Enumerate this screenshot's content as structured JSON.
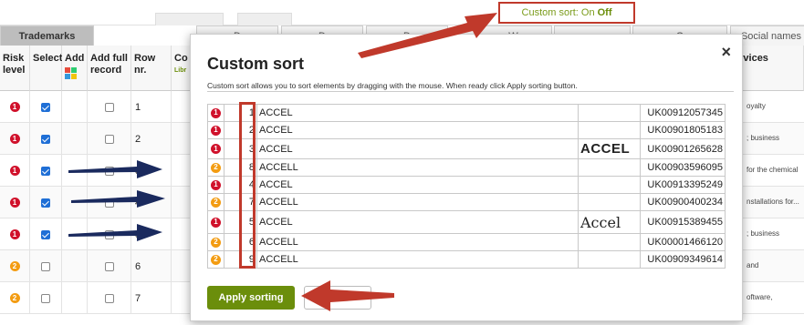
{
  "top_badge": {
    "prefix": "Custom sort: On",
    "state": "Off"
  },
  "tabs": [
    "Trademarks",
    "D",
    "D",
    "D",
    "W",
    "",
    "O",
    "Social names"
  ],
  "columns": {
    "risk": "Risk level",
    "select": "Select",
    "add": "Add",
    "add_full": "Add full record",
    "row_nr": "Row nr.",
    "co": "Co",
    "co_sub": "Libr",
    "services": "ervices"
  },
  "bg_rows": [
    {
      "risk": "1",
      "risk_level": 1,
      "checked": true,
      "nr": "1",
      "svc": "oyalty"
    },
    {
      "risk": "1",
      "risk_level": 1,
      "checked": true,
      "nr": "2",
      "svc": "; business"
    },
    {
      "risk": "1",
      "risk_level": 1,
      "checked": true,
      "nr": "3",
      "svc": "for the chemical"
    },
    {
      "risk": "1",
      "risk_level": 1,
      "checked": true,
      "nr": "4",
      "svc": "nstallations for..."
    },
    {
      "risk": "1",
      "risk_level": 1,
      "checked": true,
      "nr": "5",
      "svc": "; business"
    },
    {
      "risk": "2",
      "risk_level": 2,
      "checked": false,
      "nr": "6",
      "svc": "and"
    },
    {
      "risk": "2",
      "risk_level": 2,
      "checked": false,
      "nr": "7",
      "svc": "oftware,"
    }
  ],
  "modal": {
    "title": "Custom sort",
    "close": "×",
    "description": "Custom sort allows you to sort elements by dragging with the mouse. When ready click Apply sorting button.",
    "apply_label": "Apply sorting",
    "cancel_label": "",
    "rows": [
      {
        "risk": "1",
        "pos": "1",
        "name": "ACCEL",
        "logo": "",
        "number": "UK00912057345"
      },
      {
        "risk": "1",
        "pos": "2",
        "name": "ACCEL",
        "logo": "",
        "number": "UK00901805183"
      },
      {
        "risk": "1",
        "pos": "3",
        "name": "ACCEL",
        "logo": "ACCEL",
        "number": "UK00901265628"
      },
      {
        "risk": "2",
        "pos": "8",
        "name": "ACCELL",
        "logo": "",
        "number": "UK00903596095"
      },
      {
        "risk": "1",
        "pos": "4",
        "name": "ACCEL",
        "logo": "",
        "number": "UK00913395249"
      },
      {
        "risk": "2",
        "pos": "7",
        "name": "ACCELL",
        "logo": "",
        "number": "UK00900400234"
      },
      {
        "risk": "1",
        "pos": "5",
        "name": "ACCEL",
        "logo": "Accel",
        "number": "UK00915389455"
      },
      {
        "risk": "2",
        "pos": "6",
        "name": "ACCELL",
        "logo": "",
        "number": "UK00001466120"
      },
      {
        "risk": "2",
        "pos": "9",
        "name": "ACCELL",
        "logo": "",
        "number": "UK00909349614"
      }
    ]
  },
  "colors": {
    "risk_high": "#d0112b",
    "risk_medium": "#f39c12",
    "apply_green": "#6b8e0b",
    "annotation_red": "#c0392b",
    "annotation_navy": "#1a2a5e"
  }
}
